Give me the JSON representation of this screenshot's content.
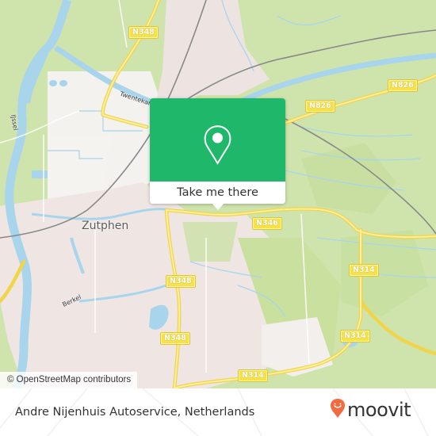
{
  "map": {
    "city_label": "Zutphen",
    "labels": {
      "ijssel": "IJssel",
      "berkel": "Berkel",
      "twentekanaal": "Twentekanaal"
    },
    "road_shields": [
      {
        "id": "n348-north",
        "label": "N348"
      },
      {
        "id": "n826-west",
        "label": "N826"
      },
      {
        "id": "n826-east",
        "label": "N826"
      },
      {
        "id": "n346",
        "label": "N346"
      },
      {
        "id": "n348-mid",
        "label": "N348"
      },
      {
        "id": "n348-south",
        "label": "N348"
      },
      {
        "id": "n314-east",
        "label": "N314"
      },
      {
        "id": "n314-southeast",
        "label": "N314"
      },
      {
        "id": "n314-south",
        "label": "N314"
      }
    ],
    "attribution": "© OpenStreetMap contributors",
    "colors": {
      "land": "#cfe4ad",
      "urban": "#efe6e3",
      "water": "#a8d4ec",
      "road": "#f7e14b"
    }
  },
  "popup": {
    "button_label": "Take me there",
    "pin_icon": "map-pin-icon",
    "color": "#1fb86a"
  },
  "footer": {
    "place_name": "Andre Nijenhuis Autoservice, Netherlands",
    "logo_text": "moovit",
    "logo_color": "#f26a3d"
  }
}
